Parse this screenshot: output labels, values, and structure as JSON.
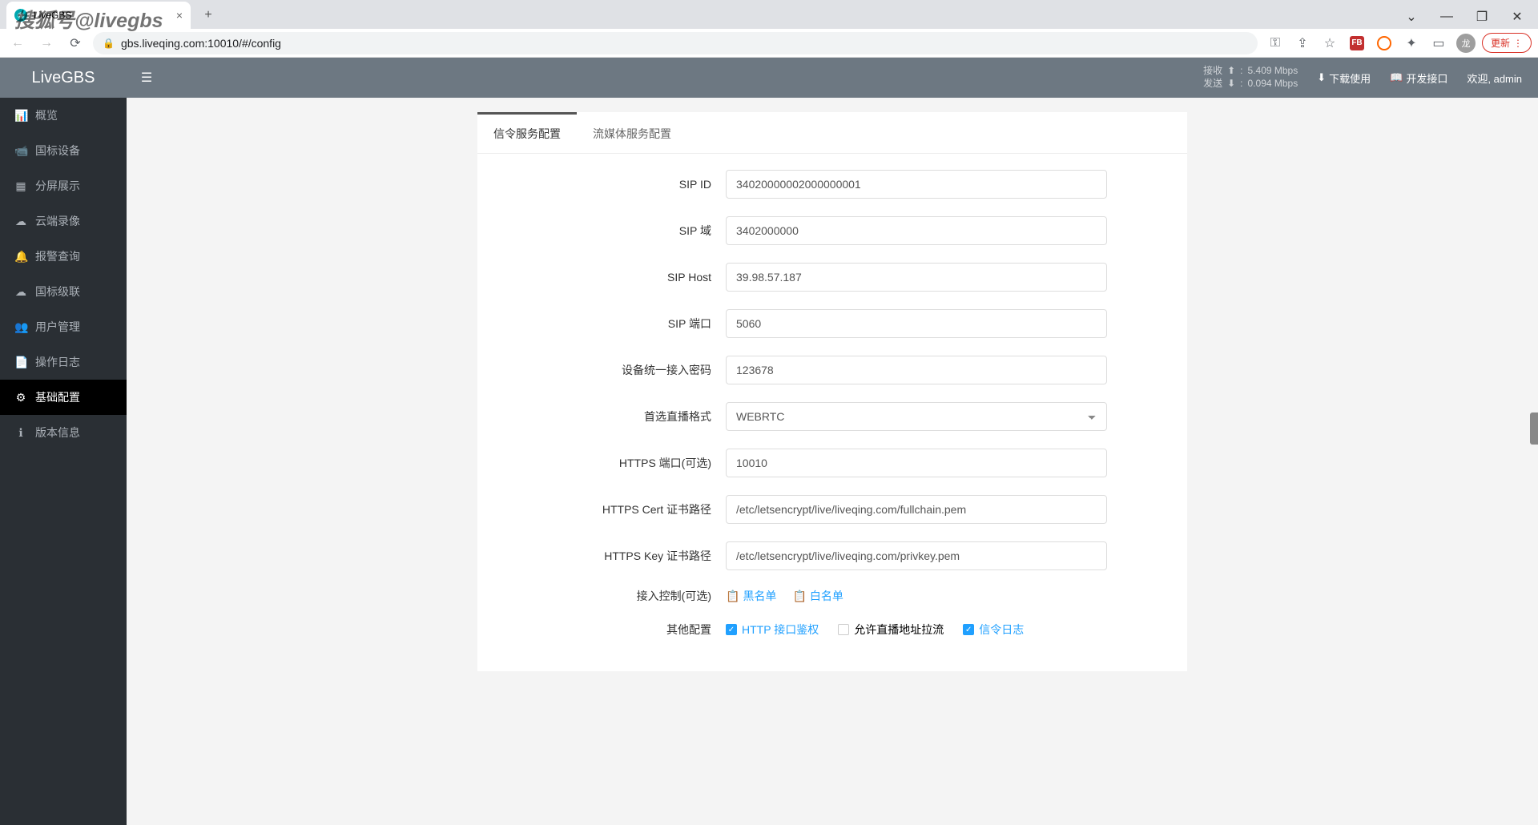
{
  "browser": {
    "tab_title": "LiveGBS",
    "url": "gbs.liveqing.com:10010/#/config",
    "update_label": "更新",
    "avatar_letter": "龙"
  },
  "watermark": "搜狐号@livegbs",
  "header": {
    "logo": "LiveGBS",
    "recv_label": "接收",
    "send_label": "发送",
    "recv_rate": "5.409 Mbps",
    "send_rate": "0.094 Mbps",
    "download_label": "下载使用",
    "api_label": "开发接口",
    "welcome_label": "欢迎, admin"
  },
  "sidebar": {
    "items": [
      {
        "icon": "📊",
        "label": "概览"
      },
      {
        "icon": "📹",
        "label": "国标设备"
      },
      {
        "icon": "▦",
        "label": "分屏展示"
      },
      {
        "icon": "☁",
        "label": "云端录像"
      },
      {
        "icon": "🔔",
        "label": "报警查询"
      },
      {
        "icon": "☁",
        "label": "国标级联"
      },
      {
        "icon": "👥",
        "label": "用户管理"
      },
      {
        "icon": "📄",
        "label": "操作日志"
      },
      {
        "icon": "⚙",
        "label": "基础配置"
      },
      {
        "icon": "ℹ",
        "label": "版本信息"
      }
    ],
    "active_index": 8
  },
  "tabs": [
    {
      "label": "信令服务配置",
      "active": true
    },
    {
      "label": "流媒体服务配置",
      "active": false
    }
  ],
  "form": {
    "sip_id": {
      "label": "SIP ID",
      "value": "34020000002000000001"
    },
    "sip_domain": {
      "label": "SIP 域",
      "value": "3402000000"
    },
    "sip_host": {
      "label": "SIP Host",
      "value": "39.98.57.187"
    },
    "sip_port": {
      "label": "SIP 端口",
      "value": "5060"
    },
    "device_pwd": {
      "label": "设备统一接入密码",
      "value": "123678"
    },
    "live_format": {
      "label": "首选直播格式",
      "value": "WEBRTC"
    },
    "https_port": {
      "label": "HTTPS 端口(可选)",
      "value": "10010"
    },
    "https_cert": {
      "label": "HTTPS Cert 证书路径",
      "value": "/etc/letsencrypt/live/liveqing.com/fullchain.pem"
    },
    "https_key": {
      "label": "HTTPS Key 证书路径",
      "value": "/etc/letsencrypt/live/liveqing.com/privkey.pem"
    },
    "access_control": {
      "label": "接入控制(可选)",
      "blacklist": "黑名单",
      "whitelist": "白名单"
    },
    "other": {
      "label": "其他配置",
      "http_auth": {
        "label": "HTTP 接口鉴权",
        "checked": true
      },
      "allow_stream": {
        "label": "允许直播地址拉流",
        "checked": false
      },
      "signal_log": {
        "label": "信令日志",
        "checked": true
      }
    }
  }
}
